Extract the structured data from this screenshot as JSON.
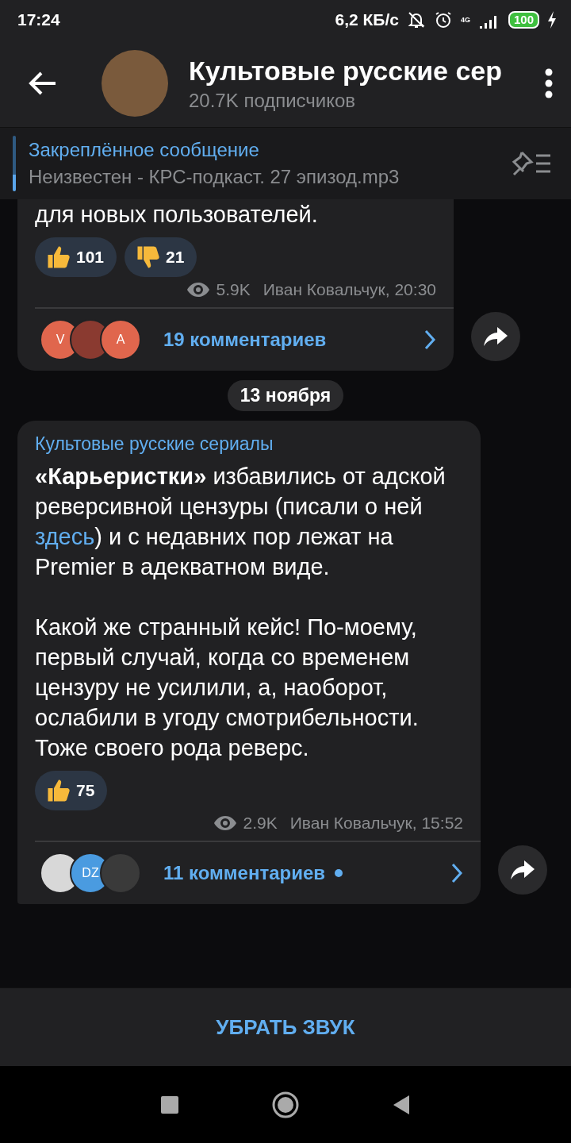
{
  "status_bar": {
    "time": "17:24",
    "speed": "6,2 КБ/с",
    "network": "4G",
    "battery": "100"
  },
  "header": {
    "title": "Культовые русские сер",
    "subtitle": "20.7K подписчиков"
  },
  "pinned": {
    "title": "Закреплённое сообщение",
    "text": "Неизвестен - КРС-подкаст. 27 эпизод.mp3"
  },
  "messages": [
    {
      "paragraphs": [
        {
          "before": "для новых пользователей."
        }
      ],
      "reactions": [
        {
          "kind": "up",
          "count": "101"
        },
        {
          "kind": "down",
          "count": "21"
        }
      ],
      "views": "5.9K",
      "signature": "Иван Ковальчук, 20:30",
      "commenters": [
        {
          "kind": "letter",
          "letter": "V",
          "color": "#e0664d"
        },
        {
          "kind": "photo",
          "color": "#8a3a30"
        },
        {
          "kind": "letter",
          "letter": "A",
          "color": "#e0664d"
        }
      ],
      "comments": "19 комментариев",
      "unread": false
    },
    {
      "date": "13 ноября",
      "author": "Культовые русские сериалы",
      "paragraphs": [
        {
          "before": "**«Карьеристки»** избавились от адской реверсивной цензуры (писали о ней ",
          "link": "здесь",
          "after": ") и с недавних пор лежат на Premier в адекватном виде."
        },
        {
          "before": "Какой же странный кейс! По-моему, первый случай, когда со временем цензуру не усилили, а, наоборот, ослабили в угоду смотрибельности. Тоже своего рода реверс."
        }
      ],
      "reactions": [
        {
          "kind": "up",
          "count": "75"
        }
      ],
      "views": "2.9K",
      "signature": "Иван Ковальчук, 15:52",
      "commenters": [
        {
          "kind": "photo",
          "color": "#d8d8d8"
        },
        {
          "kind": "letter",
          "letter": "DZ",
          "color": "#4a9be0"
        },
        {
          "kind": "photo",
          "color": "#3a3a3a"
        }
      ],
      "comments": "11 комментариев",
      "unread": true
    }
  ],
  "mute_button": "УБРАТЬ ЗВУК"
}
